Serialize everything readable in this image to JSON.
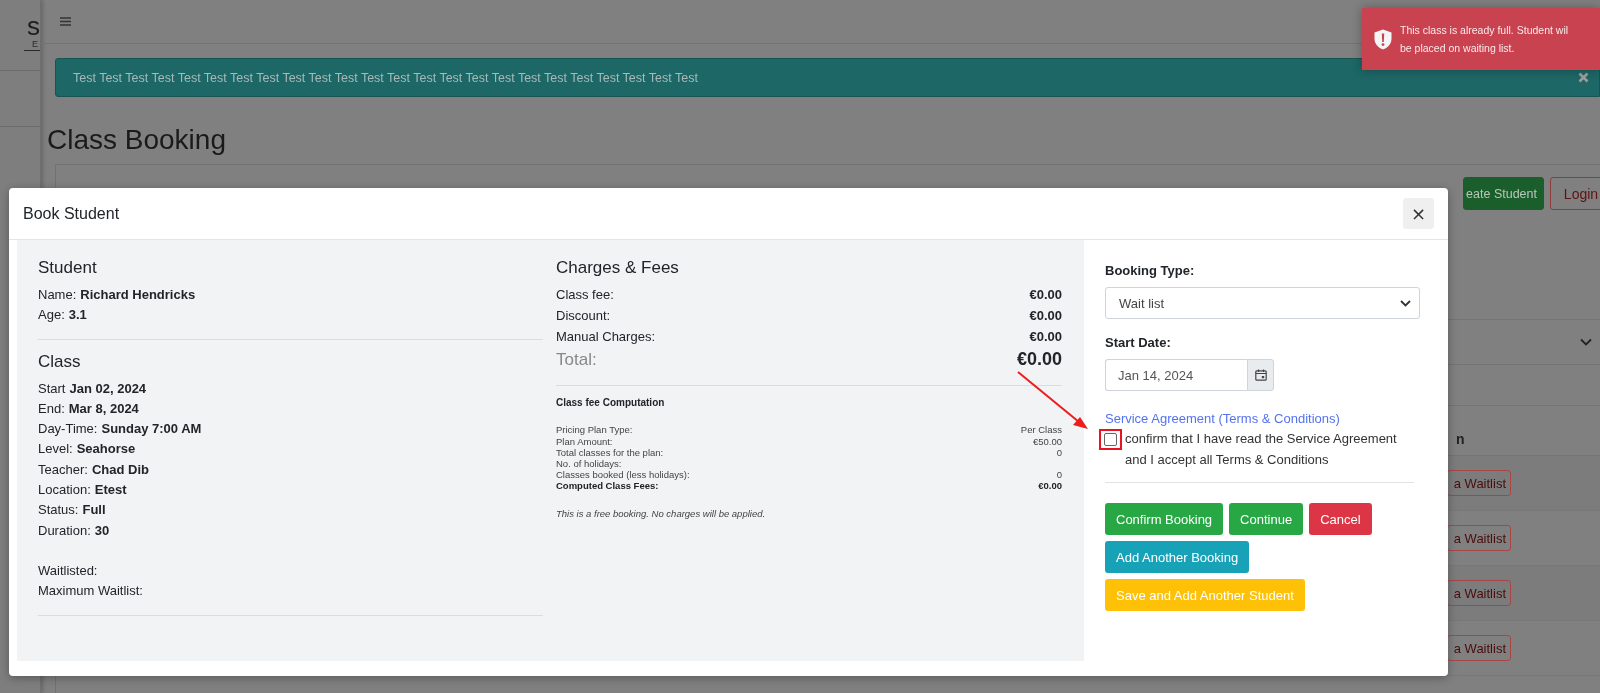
{
  "sidebar": {
    "logo": {
      "line_1": "s",
      "line_2": "E"
    }
  },
  "banner": {
    "text": "Test Test Test Test Test Test Test Test Test Test Test Test Test Test Test Test Test Test Test Test Test Test Test Test"
  },
  "page_title": "Class Booking",
  "page_buttons": [
    {
      "label": "eate Student",
      "kind": "success"
    },
    {
      "label": "Login",
      "kind": "outline"
    }
  ],
  "table": {
    "column_fragment": "n",
    "row_buttons": [
      "a Waitlist",
      "a Waitlist",
      "a Waitlist",
      "a Waitlist"
    ]
  },
  "toast": {
    "lines": [
      "This class is already full. Student wil",
      "be placed on waiting list."
    ]
  },
  "modal": {
    "title": "Book Student",
    "close": "×",
    "student": {
      "heading": "Student",
      "fields": [
        {
          "label": "Name:",
          "value": "Richard Hendricks"
        },
        {
          "label": "Age:",
          "value": "3.1"
        }
      ]
    },
    "class": {
      "heading": "Class",
      "fields": [
        {
          "label": "Start",
          "value": "Jan 02, 2024"
        },
        {
          "label": "End:",
          "value": "Mar 8, 2024"
        },
        {
          "label": "Day-Time:",
          "value": "Sunday 7:00 AM"
        },
        {
          "label": "Level:",
          "value": "Seahorse"
        },
        {
          "label": "Teacher:",
          "value": "Chad Dib"
        },
        {
          "label": "Location:",
          "value": "Etest"
        },
        {
          "label": "Status:",
          "value": "Full"
        },
        {
          "label": "Duration:",
          "value": "30"
        }
      ],
      "waitlist_fields": [
        {
          "label": "Waitlisted:"
        },
        {
          "label": "Maximum Waitlist:"
        }
      ]
    },
    "charges": {
      "heading": "Charges & Fees",
      "rows": [
        {
          "label": "Class fee:",
          "value": "€0.00"
        },
        {
          "label": "Discount:",
          "value": "€0.00"
        },
        {
          "label": "Manual Charges:",
          "value": "€0.00"
        }
      ],
      "total": {
        "label": "Total:",
        "value": "€0.00"
      }
    },
    "computation": {
      "heading": "Class fee Computation",
      "rows": [
        {
          "label": "Pricing Plan Type:",
          "value": "Per Class",
          "emphasis": false
        },
        {
          "label": "Plan Amount:",
          "value": "€50.00",
          "emphasis": false
        },
        {
          "label": "Total classes for the plan:",
          "value": "0",
          "emphasis": false
        },
        {
          "label": "No. of holidays:",
          "emphasis": false
        },
        {
          "label": "Classes booked (less holidays):",
          "value": "0",
          "emphasis": false
        },
        {
          "label": "Computed Class Fees:",
          "value": "€0.00",
          "emphasis": true
        }
      ],
      "note": "This is a free booking. No charges will be applied."
    },
    "form": {
      "booking_type": {
        "label": "Booking Type:",
        "value": "Wait list"
      },
      "start_date": {
        "label": "Start Date:",
        "value": "Jan 14, 2024"
      },
      "agreement_link": "Service Agreement (Terms & Conditions)",
      "agreement": {
        "checked": false,
        "text": "confirm that I have read the Service Agreement and I accept all Terms & Conditions"
      },
      "buttons": [
        {
          "label": "Confirm Booking",
          "kind": "success"
        },
        {
          "label": "Continue",
          "kind": "success"
        },
        {
          "label": "Cancel",
          "kind": "danger"
        },
        {
          "label": "Add Another Booking",
          "kind": "info"
        },
        {
          "label": "Save and Add Another Student",
          "kind": "warning"
        }
      ]
    }
  }
}
